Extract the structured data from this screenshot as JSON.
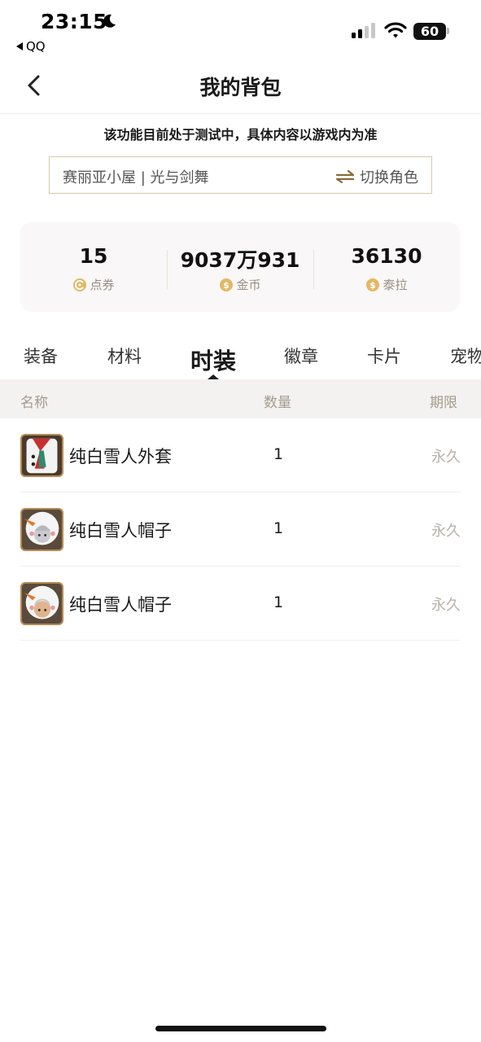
{
  "status_bar": {
    "time": "23:15",
    "back_app": "QQ",
    "battery": "60"
  },
  "nav": {
    "title": "我的背包"
  },
  "notice": "该功能目前处于测试中，具体内容以游戏内为准",
  "role": {
    "name": "赛丽亚小屋 | 光与剑舞",
    "switch_label": "切换角色"
  },
  "stats": [
    {
      "value": "15",
      "label": "点券",
      "icon": "coupon-icon"
    },
    {
      "value": "9037万931",
      "label": "金币",
      "icon": "coin-icon"
    },
    {
      "value": "36130",
      "label": "泰拉",
      "icon": "coin-icon"
    }
  ],
  "tabs": [
    {
      "label": "装备"
    },
    {
      "label": "材料"
    },
    {
      "label": "时装"
    },
    {
      "label": "徽章"
    },
    {
      "label": "卡片"
    },
    {
      "label": "宠物"
    }
  ],
  "active_tab": "时装",
  "table": {
    "headers": {
      "name": "名称",
      "qty": "数量",
      "term": "期限"
    },
    "rows": [
      {
        "name": "纯白雪人外套",
        "qty": "1",
        "term": "永久",
        "icon": "snowman-coat-icon"
      },
      {
        "name": "纯白雪人帽子",
        "qty": "1",
        "term": "永久",
        "icon": "snowman-hat-icon"
      },
      {
        "name": "纯白雪人帽子",
        "qty": "1",
        "term": "永久",
        "icon": "snowman-hat-icon"
      }
    ]
  },
  "colors": {
    "accent_gold": "#d9b36a",
    "border_beige": "#d9c9ae",
    "muted_text": "#a39a90"
  }
}
